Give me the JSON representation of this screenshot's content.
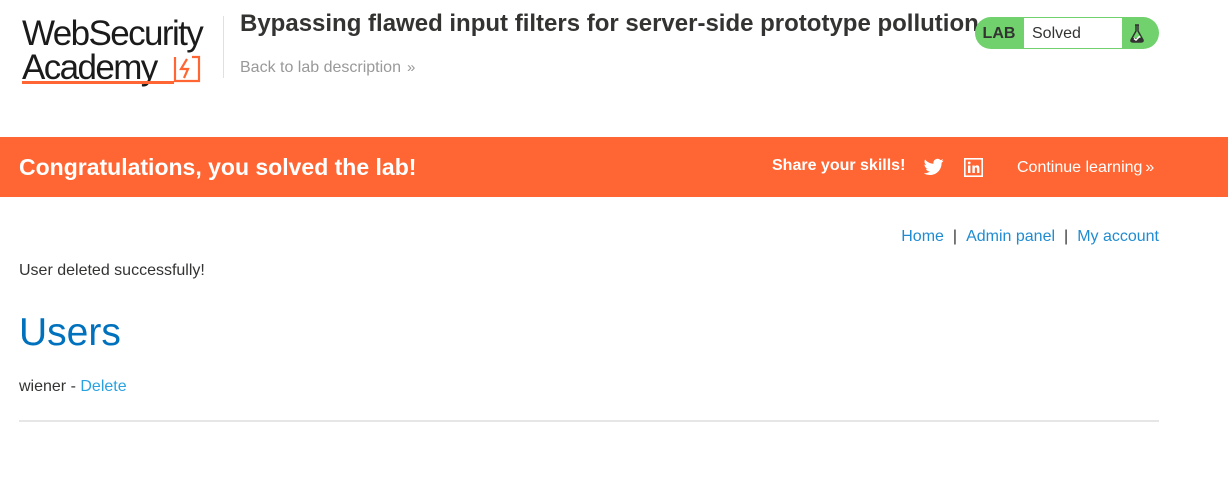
{
  "logo": {
    "line1": "WebSecurity",
    "line2": "Academy"
  },
  "lab": {
    "title": "Bypassing flawed input filters for server-side prototype pollution",
    "back_link": "Back to lab description",
    "back_chevron": "»",
    "status_label": "LAB",
    "status_value": "Solved"
  },
  "banner": {
    "message": "Congratulations, you solved the lab!",
    "share_label": "Share your skills!",
    "continue_label": "Continue learning",
    "continue_chevron": "»"
  },
  "nav": {
    "home": "Home",
    "admin_panel": "Admin panel",
    "my_account": "My account",
    "separator": "|"
  },
  "main": {
    "message": "User deleted successfully!",
    "heading": "Users",
    "users": [
      {
        "name": "wiener",
        "separator": "-",
        "action": "Delete"
      }
    ]
  },
  "colors": {
    "accent": "#ff6633",
    "lab_solved": "#70d16d",
    "link": "#1f8cd1",
    "heading": "#0071bc"
  }
}
